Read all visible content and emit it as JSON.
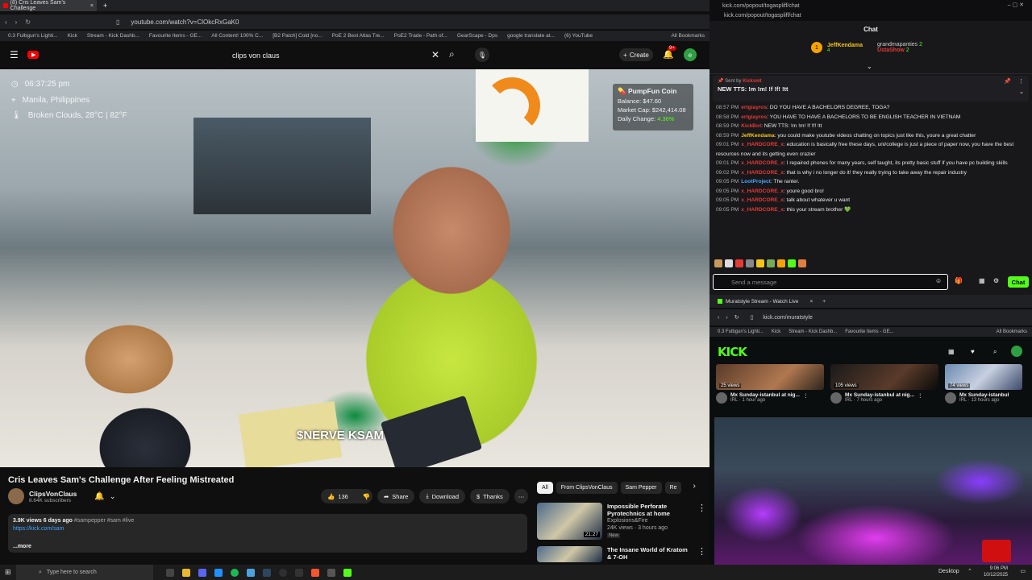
{
  "left_browser": {
    "tab_title": "(8) Cris Leaves Sam's Challenge",
    "url": "youtube.com/watch?v=ClOkcRxGaK0",
    "bookmarks": [
      "0.3 Fulbgun's Lighti...",
      "Kick",
      "Stream - Kick Dashb...",
      "Favourite Items - GE...",
      "All Content! 100% C...",
      "[B2 Patch] Cold [no...",
      "PoE 2 Best Atlas Tre...",
      "PoE2 Trade - Path of...",
      "GearScape - Dps",
      "google translate at...",
      "(6) YouTube",
      "All Bookmarks"
    ]
  },
  "youtube": {
    "search_value": "clips von claus",
    "create_label": "Create",
    "notification_count": "9+",
    "avatar_letter": "e",
    "video_overlay": {
      "time": "06:37:25 pm",
      "location": "Manila, Philippines",
      "weather": "Broken Clouds, 28°C | 82°F",
      "coin_name": "PumpFun Coin",
      "balance": "Balance: $47.60",
      "market_cap": "Market Cap: $242,414.08",
      "daily_change_label": "Daily Change:",
      "daily_change_value": "4.36%",
      "watermark": "$NERVE KSAM"
    },
    "video_title": "Cris Leaves Sam's Challenge After Feeling Mistreated",
    "channel_name": "ClipsVonClaus",
    "subscribers": "8.64K subscribers",
    "likes": "136",
    "share_label": "Share",
    "download_label": "Download",
    "thanks_label": "Thanks",
    "description": {
      "stats": "3.9K views  6 days ago",
      "tags": "#sampepper #sam #live",
      "link": "https://kick.com/sam",
      "more": "...more"
    },
    "chips": [
      "All",
      "From ClipsVonClaus",
      "Sam Pepper",
      "Re"
    ],
    "recommended": [
      {
        "title": "Impossible Perforate Pyrotechnics at home",
        "channel": "Explosions&Fire",
        "meta": "24K views · 3 hours ago",
        "badge": "New",
        "duration": "21:27"
      },
      {
        "title": "The Insane World of Kratom & 7-OH",
        "channel": "",
        "meta": "",
        "badge": "",
        "duration": ""
      }
    ]
  },
  "kick_chat": {
    "window_url": "kick.com/popout/togaspliff/chat",
    "header": "Chat",
    "top_users": [
      {
        "name": "JeffKendama",
        "count": "4"
      },
      {
        "name": "grandmapanties",
        "count": "2"
      },
      {
        "name": "UstaShow",
        "count": "2"
      }
    ],
    "pinned_by": "Sent by",
    "pinned_user": "Kicksmt",
    "pinned_text": "NEW TTS: !m !m! !f !f! !tt",
    "messages": [
      {
        "time": "08:57 PM",
        "user": "ertgiayros",
        "text": ": DO YOU HAVE A BACHELORS DEGREE, TOGA?",
        "color": "red"
      },
      {
        "time": "08:58 PM",
        "user": "ertgiayros",
        "text": ": YOU HAVE TO HAVE A BACHELORS TO BE ENGLISH TEACHER IN VIETNAM",
        "color": "red"
      },
      {
        "time": "08:59 PM",
        "user": "KickBot",
        "text": ": NEW TTS: !m !m! !f !f! !tt",
        "color": "red"
      },
      {
        "time": "08:59 PM",
        "user": "JeffKendama",
        "text": ": you could make youtube videos chatting on topics just like this, youre a great chatter",
        "color": "yellow"
      },
      {
        "time": "09:01 PM",
        "user": "x_HARDCORE_x",
        "text": ": education is basically free these days, uni/college is just a piece of paper now, you have the best resources now and its getting even crazier",
        "color": "red"
      },
      {
        "time": "09:01 PM",
        "user": "x_HARDCORE_x",
        "text": ": I repaired phones for many years, self taught, its pretty basic stuff if you have pc building skills",
        "color": "red"
      },
      {
        "time": "09:02 PM",
        "user": "x_HARDCORE_x",
        "text": ": that is why i no longer do it! they really trying to take away the repair industry",
        "color": "red"
      },
      {
        "time": "09:05 PM",
        "user": "LootProject",
        "text": ": The ranter.",
        "color": "blue"
      },
      {
        "time": "09:05 PM",
        "user": "x_HARDCORE_x",
        "text": ": youre good bro!",
        "color": "red"
      },
      {
        "time": "09:05 PM",
        "user": "x_HARDCORE_x",
        "text": ": talk about whatever u want",
        "color": "red"
      },
      {
        "time": "09:05 PM",
        "user": "x_HARDCORE_x",
        "text": ": this your stream brother 💚",
        "color": "red"
      }
    ],
    "input_placeholder": "Send a message",
    "send_label": "Chat",
    "accent": "#53fc18"
  },
  "kick_browser": {
    "tab_title": "Muratstyle Stream - Watch Live",
    "url": "kick.com/muratstyle",
    "bookmarks": [
      "0.3 Fulbgun's Lighti...",
      "Kick",
      "Stream - Kick Dashb...",
      "Favourite Items - GE...",
      "All Bookmarks"
    ],
    "logo": "KICK",
    "cards": [
      {
        "views": "25 views",
        "title": "Mx Sunday-istanbul at nig...",
        "sub": "IRL · 1 hour ago"
      },
      {
        "views": "105 views",
        "title": "Mx Sunday-istanbul at nig...",
        "sub": "IRL · 7 hours ago"
      },
      {
        "views": "74 views",
        "title": "Mx Sunday-istanbul",
        "sub": "IRL · 13 hours ago"
      }
    ]
  },
  "taskbar": {
    "search_placeholder": "Type here to search",
    "desktop_label": "Desktop",
    "time": "9:06 PM",
    "date": "10/12/2025"
  }
}
